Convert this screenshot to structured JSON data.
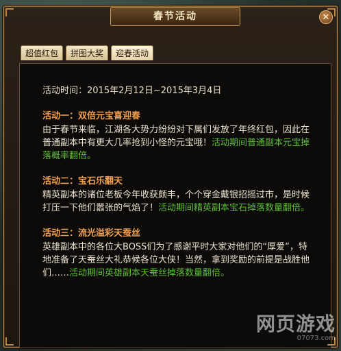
{
  "window": {
    "title": "春节活动",
    "close_label": "✕"
  },
  "tabs": [
    {
      "label": "超值红包"
    },
    {
      "label": "拼图大奖"
    },
    {
      "label": "迎春活动"
    }
  ],
  "content": {
    "event_time": "活动时间：2015年2月12日~2015年3月4日",
    "sections": [
      {
        "heading": "活动一：双倍元宝喜迎春",
        "body": "由于春节来临，江湖各大势力纷纷对下属们发放了年终红包，因此在普通副本中有更大几率抢到小怪的元宝哦！",
        "highlight": "活动期间普通副本元宝掉落概率翻倍。"
      },
      {
        "heading": "活动二：宝石乐翻天",
        "body": "精英副本的诸位老板今年收获颇丰，个个穿金戴银招摇过市，是时候打压一下他们嚣张的气焰了！",
        "highlight": "活动期间精英副本宝石掉落数量翻倍。"
      },
      {
        "heading": "活动三：流光溢彩天蚕丝",
        "body": "英雄副本中的各位大BOSS们为了感谢平时大家对他们的“厚爱”，特地准备了天蚕丝大礼恭候各位大侠！当然，拿到奖励的前提是战胜他们……",
        "highlight": "活动期间英雄副本天蚕丝掉落数量翻倍。"
      }
    ]
  },
  "watermark": {
    "main": "网页游戏",
    "sub": "07073.com"
  },
  "colors": {
    "heading": "#f0a050",
    "highlight": "#5fbf3a",
    "frame": "#8a6a3a"
  }
}
